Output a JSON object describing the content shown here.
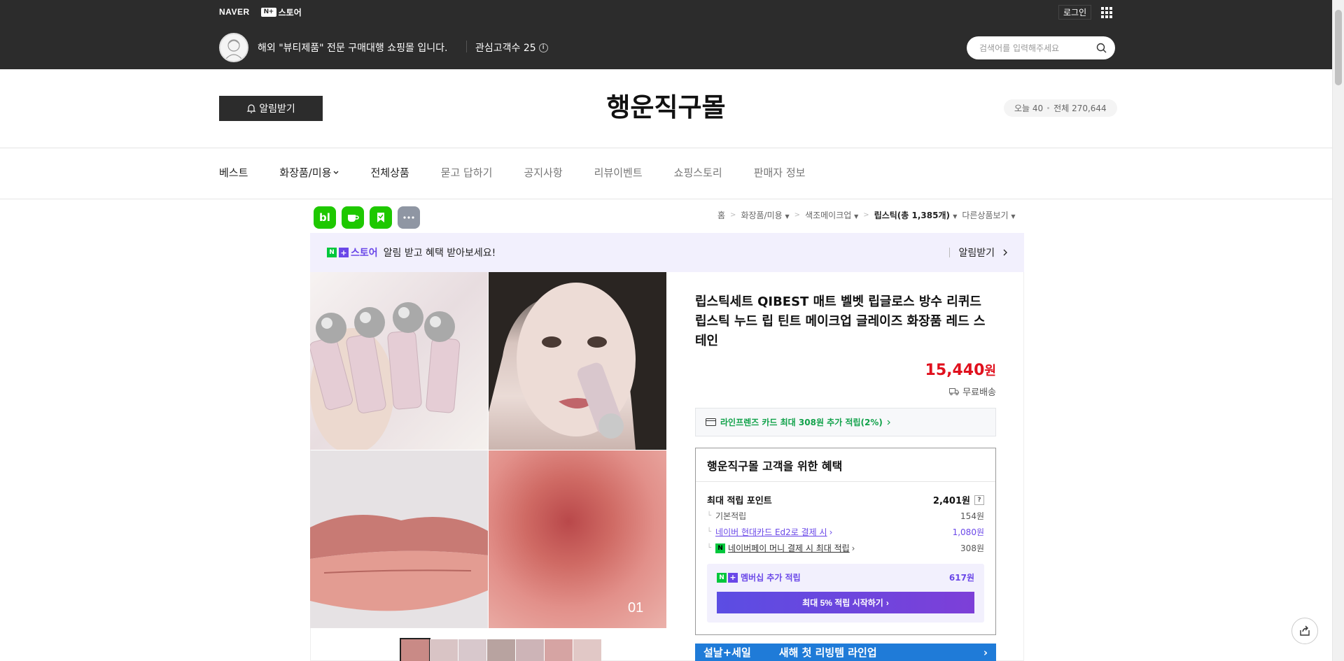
{
  "topbar": {
    "naver_label": "NAVER",
    "nstore_badge": "N+",
    "nstore_label": "스토어",
    "login_label": "로그인",
    "store_desc": "해외 \"뷰티제품\" 전문 구매대행 쇼핑몰 입니다.",
    "interest_label": "관심고객수 25",
    "search_placeholder": "검색어를 입력해주세요"
  },
  "store": {
    "alarm_label": "알림받기",
    "title": "행운직구몰",
    "visits_today": "오늘 40",
    "visits_total": "전체 270,644"
  },
  "nav": {
    "items": [
      {
        "label": "베스트"
      },
      {
        "label": "화장품/미용"
      },
      {
        "label": "전체상품"
      },
      {
        "label": "묻고 답하기"
      },
      {
        "label": "공지사항"
      },
      {
        "label": "리뷰이벤트"
      },
      {
        "label": "쇼핑스토리"
      },
      {
        "label": "판매자 정보"
      }
    ]
  },
  "social": {
    "blog": "bl"
  },
  "breadcrumb": {
    "home": "홈",
    "c1": "화장품/미용",
    "c2": "색조메이크업",
    "c3": "립스틱(총 1,385개)",
    "other": "다른상품보기"
  },
  "banner": {
    "nstore_label": "스토어",
    "text": "알림 받고 혜택 받아보세요!",
    "action": "알림받기"
  },
  "product": {
    "image_index": "01",
    "title": "립스틱세트 QIBEST 매트 벨벳 립글로스 방수 리퀴드 립스틱 누드 립 틴트 메이크업 글레이즈 화장품 레드 스테인",
    "price": "15,440",
    "price_unit": "원",
    "shipping": "무료배송",
    "card_benefit": "라인프렌즈 카드 최대 308원 추가 적립(2%)"
  },
  "benefit": {
    "title": "행운직구몰 고객을 위한 혜택",
    "max_points_label": "최대 적립 포인트",
    "max_points_value": "2,401원",
    "basic_label": "기본적립",
    "basic_value": "154원",
    "card_label": "네이버 현대카드 Ed2로 결제 시",
    "card_value": "1,080원",
    "pay_label": "네이버페이 머니 결제 시 최대 적립",
    "pay_value": "308원",
    "member_label": "멤버십 추가 적립",
    "member_value": "617원",
    "member_button": "최대 5% 적립 시작하기"
  },
  "ad": {
    "left": "설날+세일",
    "right": "새해 첫 리빙템 라인업"
  }
}
